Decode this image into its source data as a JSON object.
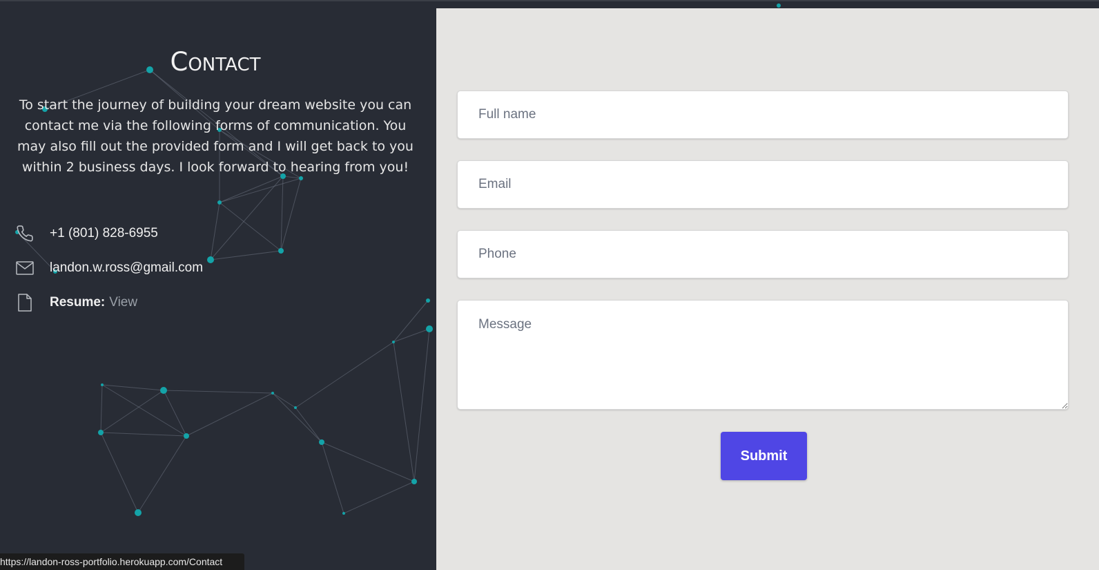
{
  "contact": {
    "title": "Contact",
    "intro": "To start the journey of building your dream website you can contact me via the following forms of communication. You may also fill out the provided form and I will get back to you within 2 business days. I look forward to hearing from you!",
    "phone": "+1 (801) 828-6955",
    "email": "landon.w.ross@gmail.com",
    "resume_label": "Resume:",
    "resume_link": "View"
  },
  "form": {
    "full_name_placeholder": "Full name",
    "email_placeholder": "Email",
    "phone_placeholder": "Phone",
    "message_placeholder": "Message",
    "submit_label": "Submit"
  },
  "status_bar": {
    "url": "https://landon-ross-portfolio.herokuapp.com/Contact"
  },
  "icons": {
    "phone": "phone-icon",
    "email": "mail-icon",
    "resume": "document-icon"
  },
  "colors": {
    "background": "#282c35",
    "form_panel": "#e5e4e2",
    "accent": "#4f46e5",
    "network_node": "#14a3a8"
  }
}
